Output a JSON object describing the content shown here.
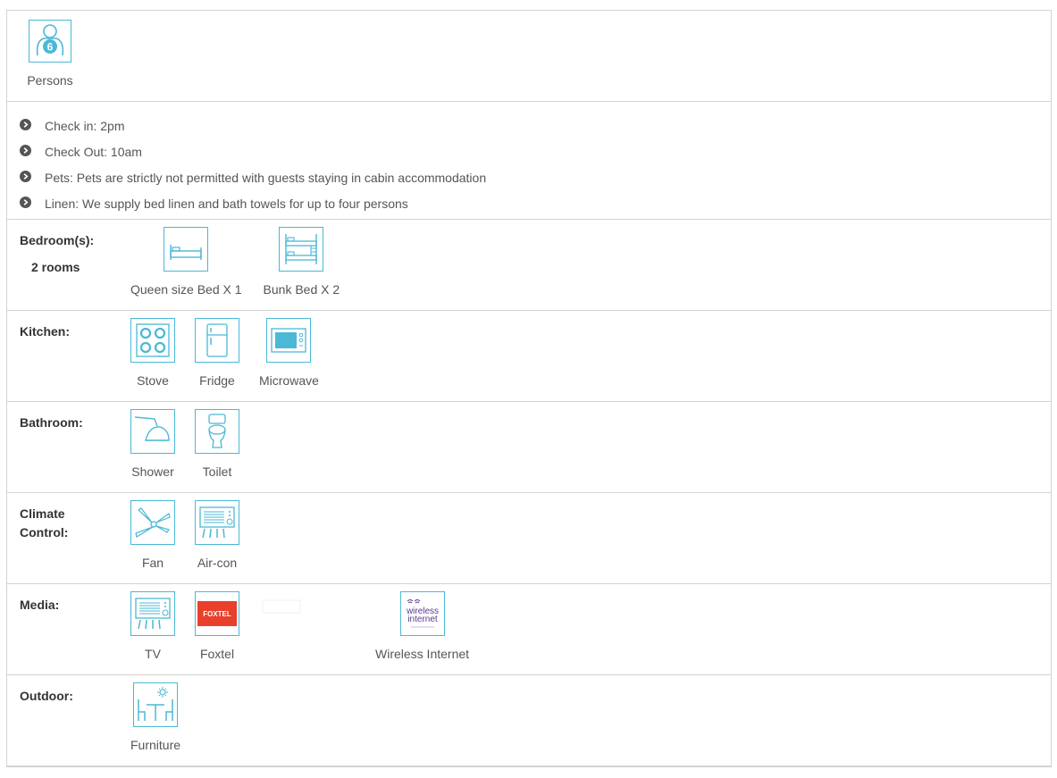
{
  "persons": {
    "count": "6",
    "label": "Persons"
  },
  "info": [
    "Check in: 2pm",
    "Check Out: 10am",
    "Pets: Pets are strictly not permitted with guests staying in cabin accommodation",
    "Linen: We supply bed linen and bath towels for up to four persons"
  ],
  "bedrooms": {
    "label": "Bedroom(s):",
    "sub": "2 rooms",
    "items": [
      {
        "label": "Queen size Bed X 1",
        "icon": "queen-bed-icon"
      },
      {
        "label": "Bunk Bed X 2",
        "icon": "bunk-bed-icon"
      }
    ]
  },
  "kitchen": {
    "label": "Kitchen:",
    "items": [
      {
        "label": "Stove",
        "icon": "stove-icon"
      },
      {
        "label": "Fridge",
        "icon": "fridge-icon"
      },
      {
        "label": "Microwave",
        "icon": "microwave-icon"
      }
    ]
  },
  "bathroom": {
    "label": "Bathroom:",
    "items": [
      {
        "label": "Shower",
        "icon": "shower-icon"
      },
      {
        "label": "Toilet",
        "icon": "toilet-icon"
      }
    ]
  },
  "climate": {
    "label_line1": "Climate",
    "label_line2": "Control:",
    "items": [
      {
        "label": "Fan",
        "icon": "fan-icon"
      },
      {
        "label": "Air-con",
        "icon": "air-con-icon"
      }
    ]
  },
  "media": {
    "label": "Media:",
    "items": [
      {
        "label": "TV",
        "icon": "tv-icon"
      },
      {
        "label": "Foxtel",
        "icon": "foxtel-logo-icon",
        "logo_text": "FOXTEL"
      },
      {
        "label": "",
        "icon": "faded-placeholder-icon"
      },
      {
        "label": "Wireless Internet",
        "icon": "wireless-internet-icon",
        "logo_text_1": "wireless",
        "logo_text_2": "internet"
      }
    ]
  },
  "outdoor": {
    "label": "Outdoor:",
    "items": [
      {
        "label": "Furniture",
        "icon": "outdoor-furniture-icon"
      }
    ]
  },
  "colors": {
    "icon_accent": "#4ab8d6",
    "foxtel_red": "#e8402a",
    "wifi_purple": "#5b3b8f",
    "border": "#d3d3d3"
  }
}
